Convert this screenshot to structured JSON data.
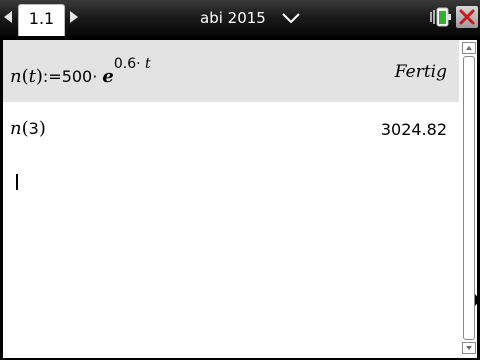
{
  "topbar": {
    "page_tab_label": "1.1",
    "document_title": "abi 2015",
    "icons": {
      "prev": "left-arrow-icon",
      "next": "right-arrow-icon",
      "menu": "chevron-down-icon",
      "battery": "battery-icon",
      "close": "close-icon"
    }
  },
  "calculator": {
    "entries": [
      {
        "input": {
          "fn": "n",
          "open": "(",
          "var": "t",
          "close": ")",
          "assign": ":=500· ",
          "base": "e",
          "exponent_num": "0.6· ",
          "exponent_var": "t"
        },
        "output": "Fertig"
      },
      {
        "input": {
          "fn": "n",
          "open": "(",
          "arg": "3",
          "close": ")"
        },
        "output": "3024.82"
      }
    ]
  },
  "colors": {
    "history_highlight": "#e3e3e3",
    "close_x": "#d4161c",
    "battery_green": "#31b22a"
  }
}
